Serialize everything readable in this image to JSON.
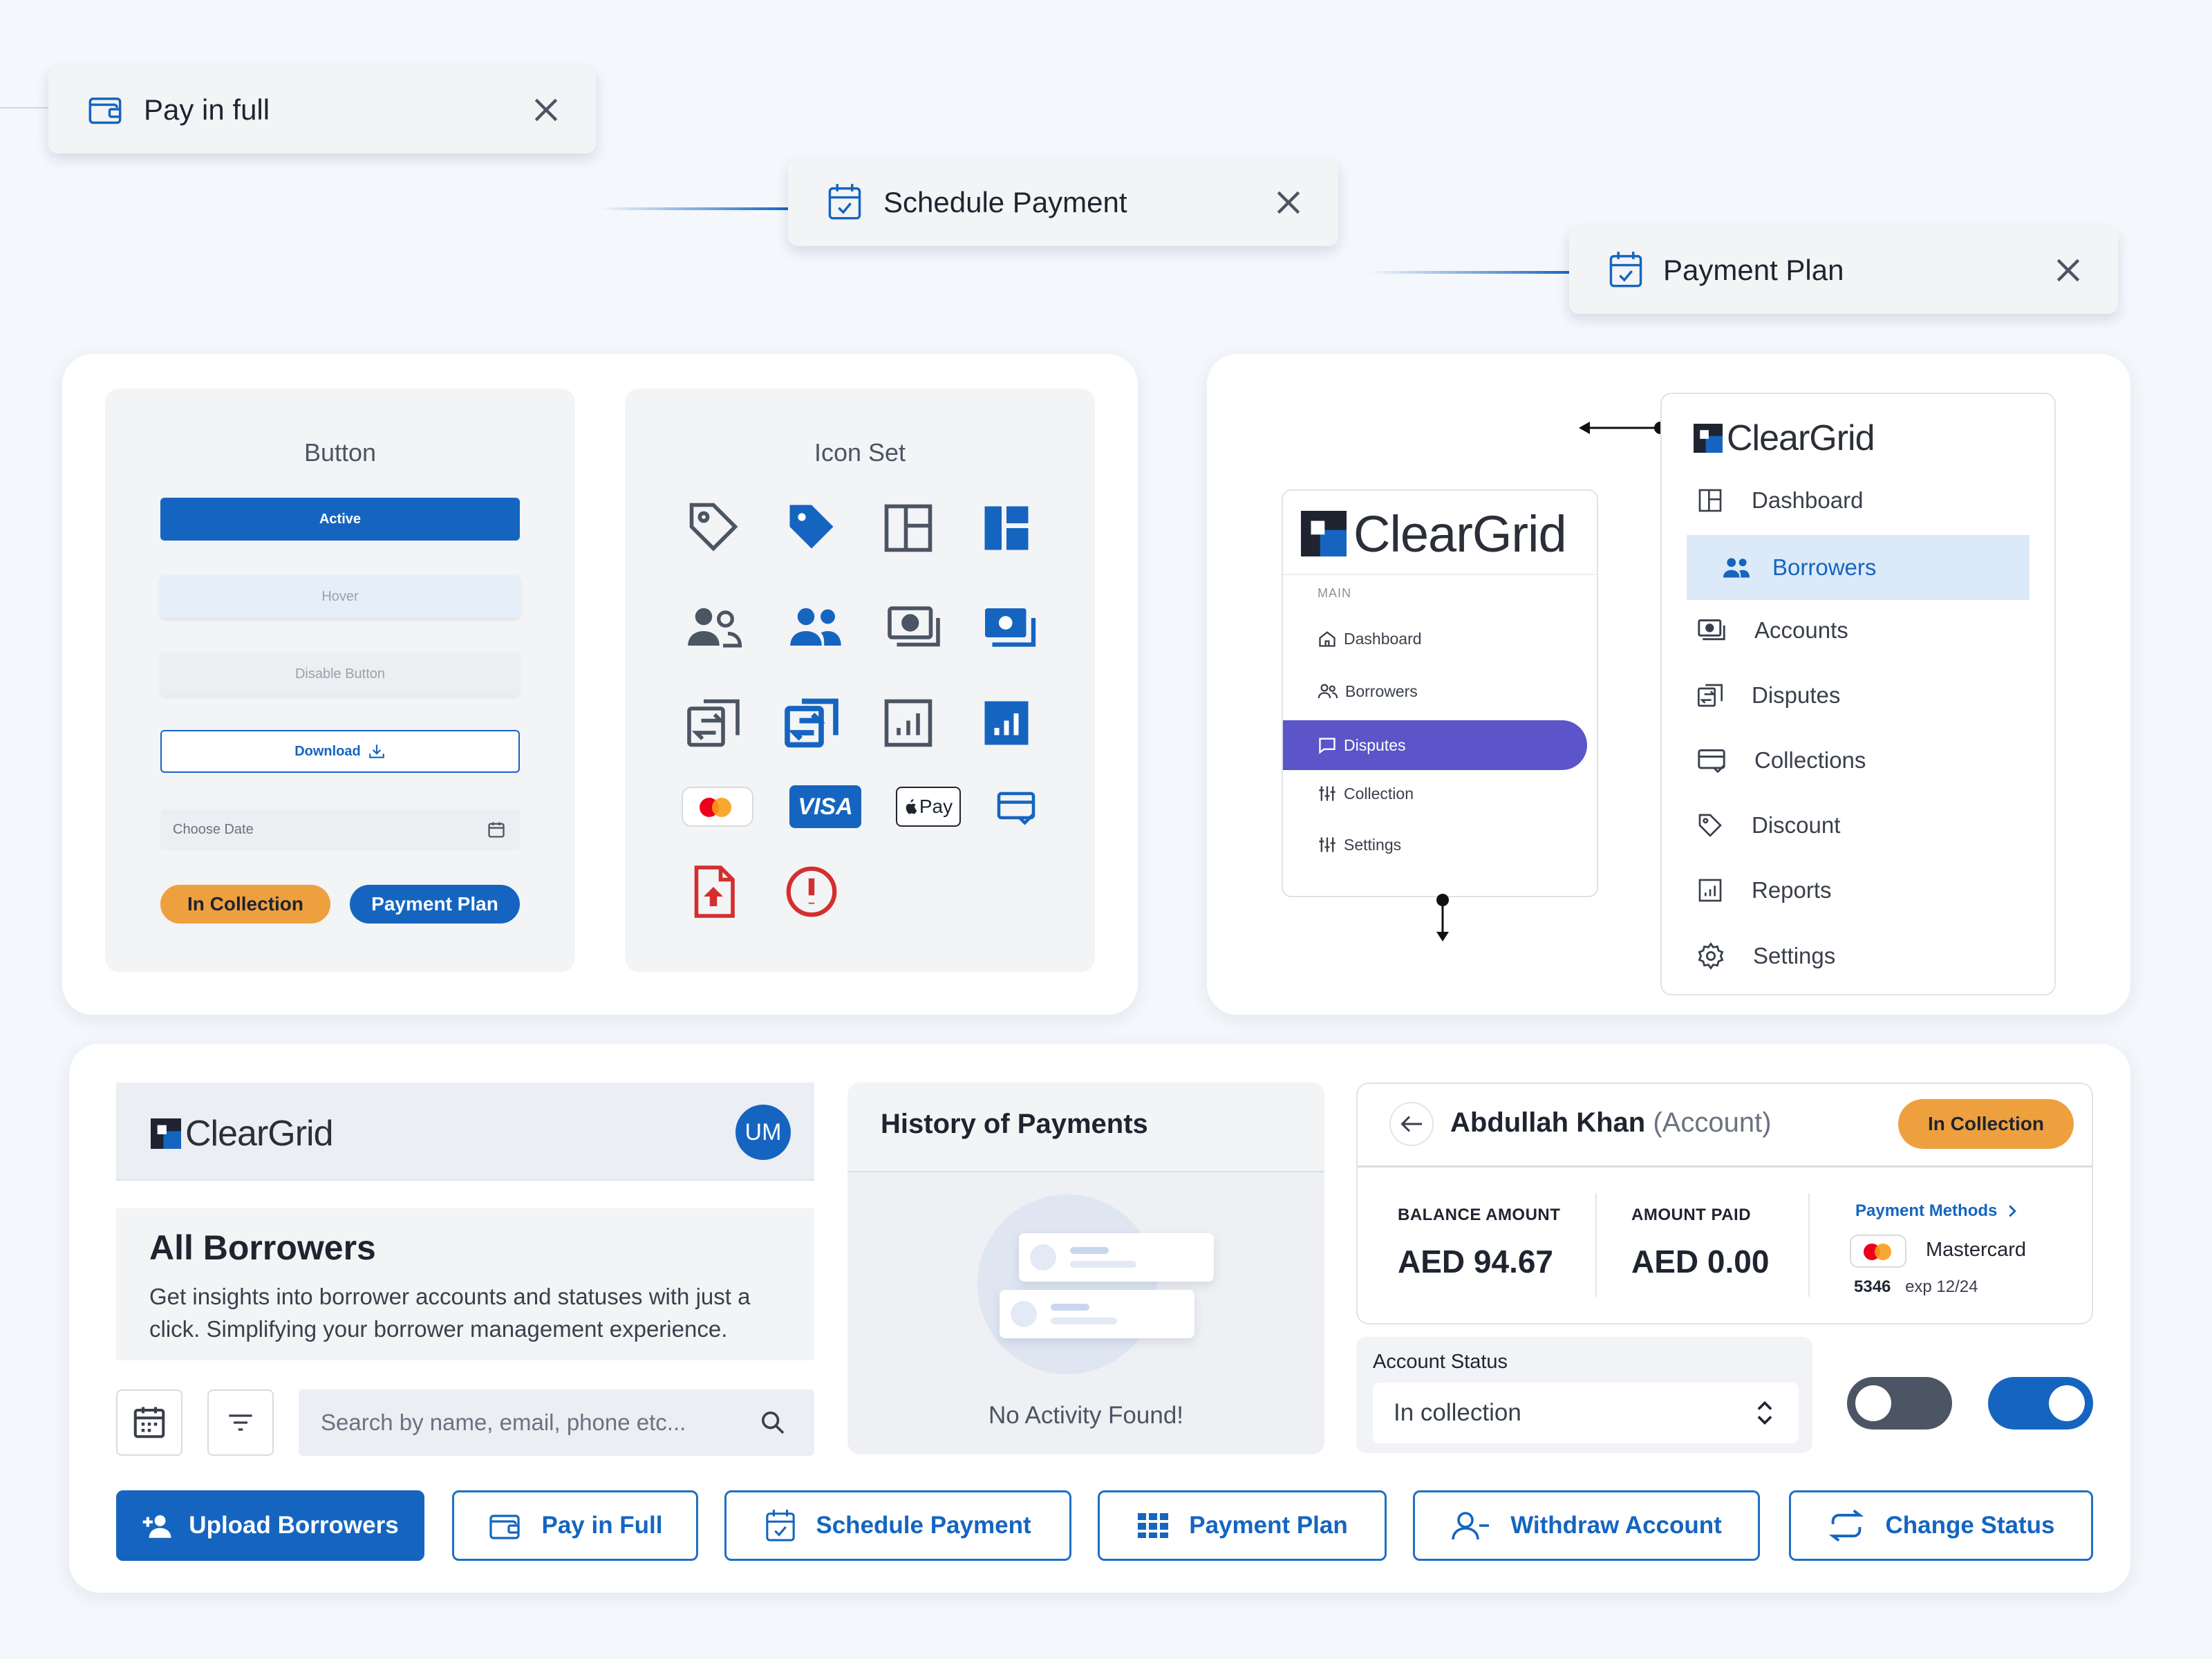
{
  "chips": {
    "pay_full": "Pay in full",
    "schedule": "Schedule Payment",
    "plan": "Payment Plan"
  },
  "buttons_panel": {
    "title": "Button",
    "active": "Active",
    "hover": "Hover",
    "disabled": "Disable Button",
    "download": "Download",
    "date_placeholder": "Choose Date",
    "tag_collection": "In Collection",
    "tag_plan": "Payment Plan"
  },
  "icons_panel": {
    "title": "Icon Set",
    "visa": "VISA",
    "apple_pay": "Pay",
    "icons": [
      "tag-outline-icon",
      "tag-filled-icon",
      "layout-outline-icon",
      "layout-filled-icon",
      "users-outline-icon",
      "users-filled-icon",
      "money-outline-icon",
      "money-filled-icon",
      "transfer-outline-icon",
      "transfer-filled-icon",
      "report-outline-icon",
      "report-filled-icon",
      "mastercard-icon",
      "visa-icon",
      "apple-pay-icon",
      "card-check-icon",
      "file-upload-icon",
      "alert-icon"
    ]
  },
  "sidebar_small": {
    "brand": "ClearGrid",
    "section": "MAIN",
    "items": [
      "Dashboard",
      "Borrowers",
      "Disputes",
      "Collection",
      "Settings"
    ],
    "active": "Disputes",
    "active_color": "#5b55c9"
  },
  "sidebar_large": {
    "brand": "ClearGrid",
    "items": [
      "Dashboard",
      "Borrowers",
      "Accounts",
      "Disputes",
      "Collections",
      "Discount",
      "Reports",
      "Settings"
    ],
    "active": "Borrowers"
  },
  "borrowers": {
    "brand": "ClearGrid",
    "avatar": "UM",
    "heading": "All Borrowers",
    "description": "Get insights into borrower accounts and statuses with just a click. Simplifying your borrower management experience.",
    "search_placeholder": "Search by name, email, phone etc..."
  },
  "history": {
    "title": "History of Payments",
    "empty": "No Activity Found!"
  },
  "account": {
    "name": "Abdullah Khan",
    "suffix": "(Account)",
    "status_badge": "In Collection",
    "balance_label": "BALANCE AMOUNT",
    "balance_value": "AED 94.67",
    "paid_label": "AMOUNT PAID",
    "paid_value": "AED 0.00",
    "methods_link": "Payment Methods",
    "card_brand": "Mastercard",
    "card_last4": "5346",
    "card_exp": "exp 12/24",
    "status_label": "Account Status",
    "status_value": "In collection",
    "toggle_off": false,
    "toggle_on": true
  },
  "actions": {
    "upload": "Upload Borrowers",
    "pay_full": "Pay in Full",
    "schedule": "Schedule Payment",
    "plan": "Payment Plan",
    "withdraw": "Withdraw Account",
    "change_status": "Change Status"
  },
  "colors": {
    "primary": "#1565c0",
    "orange": "#eea03f",
    "red": "#d32f2f",
    "purple": "#5b55c9",
    "bg": "#f4f7fb"
  }
}
